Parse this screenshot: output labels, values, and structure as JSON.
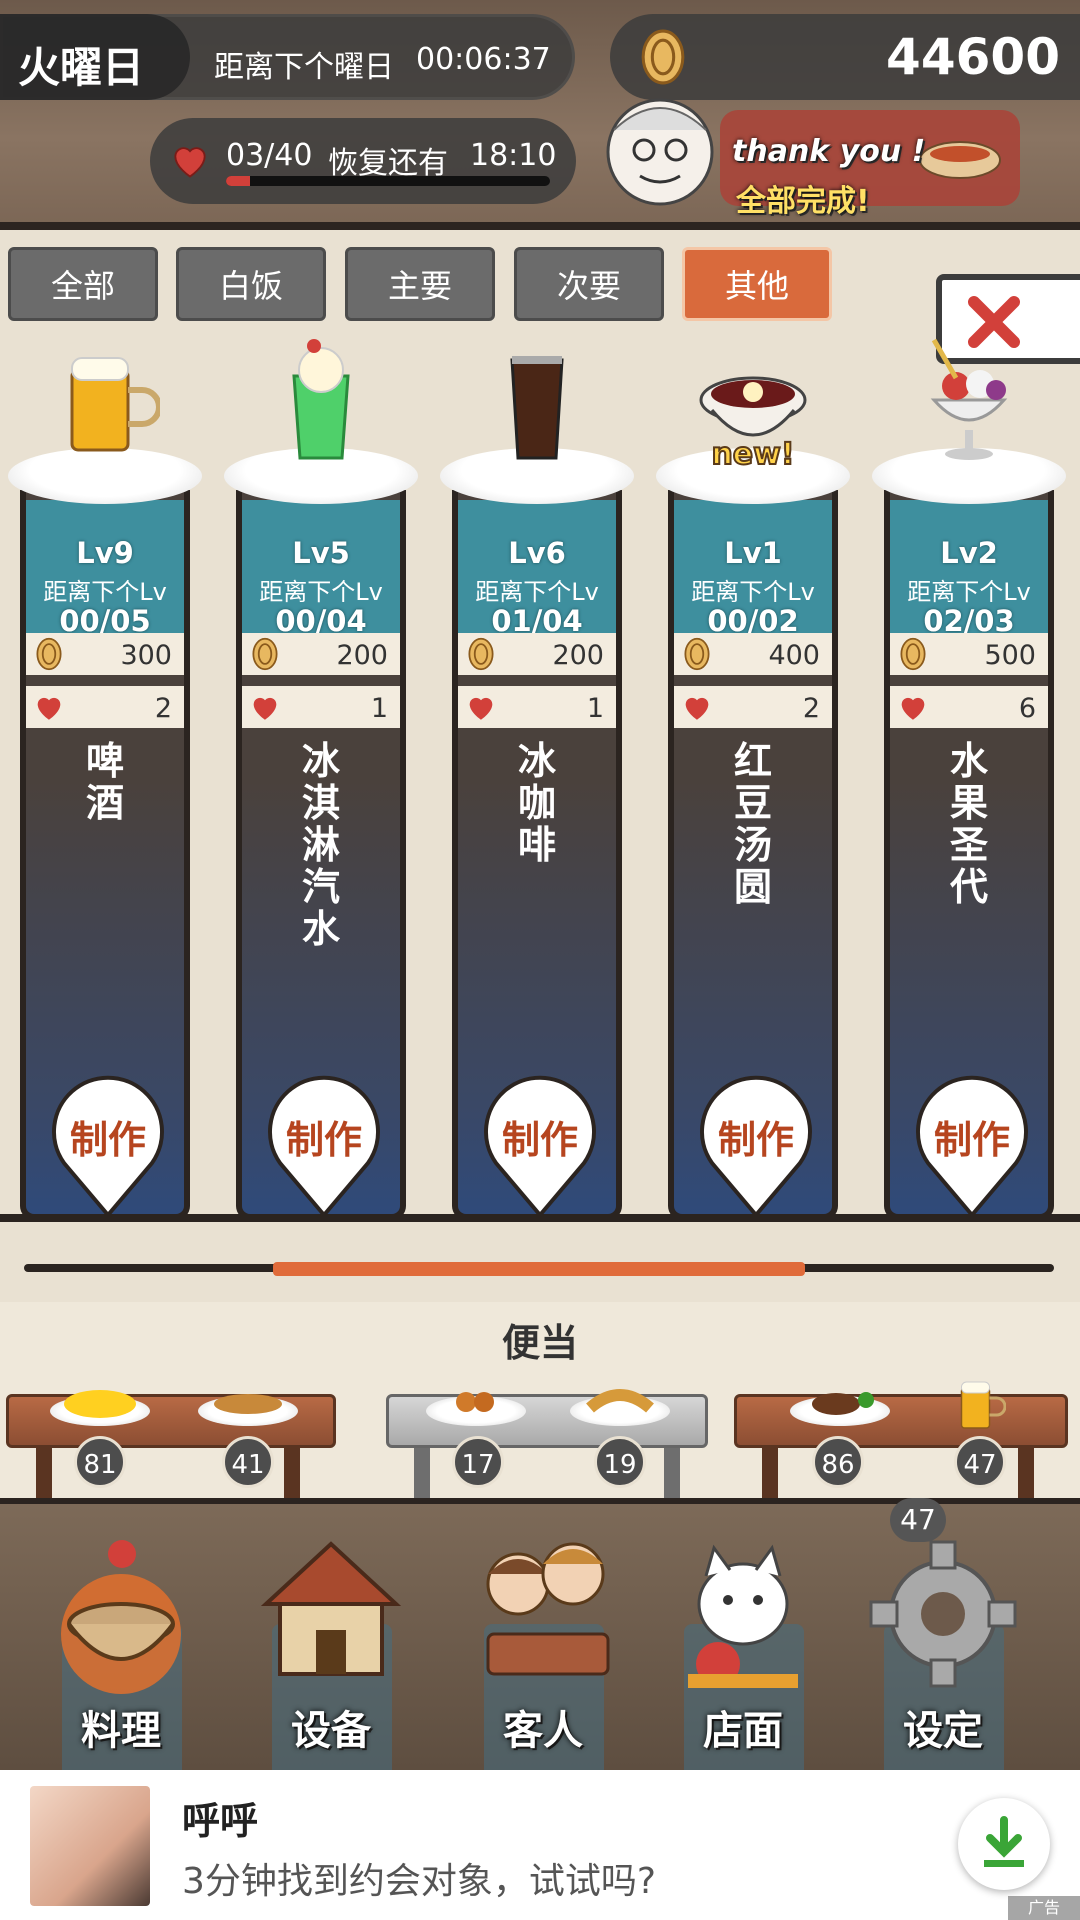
{
  "hud": {
    "day": "火曜日",
    "countdown_label": "距离下个曜日",
    "countdown_time": "00:06:37",
    "hearts": "03/40",
    "hearts_fraction": 0.075,
    "recover_label": "恢复还有",
    "recover_time": "18:10",
    "coins": "44600",
    "banner_line1": "thank you !",
    "banner_line2": "全部完成!"
  },
  "tabs": [
    {
      "label": "全部",
      "active": false
    },
    {
      "label": "白饭",
      "active": false
    },
    {
      "label": "主要",
      "active": false
    },
    {
      "label": "次要",
      "active": false
    },
    {
      "label": "其他",
      "active": true
    }
  ],
  "dishes": [
    {
      "icon": "beer-icon",
      "lv": "Lv9",
      "next_label": "距离下个Lv",
      "progress": "00/05",
      "price": "300",
      "hearts": "2",
      "name": "啤酒",
      "make": "制作",
      "badge": ""
    },
    {
      "icon": "cream-soda-icon",
      "lv": "Lv5",
      "next_label": "距离下个Lv",
      "progress": "00/04",
      "price": "200",
      "hearts": "1",
      "name": "冰淇淋汽水",
      "make": "制作",
      "badge": ""
    },
    {
      "icon": "iced-coffee-icon",
      "lv": "Lv6",
      "next_label": "距离下个Lv",
      "progress": "01/04",
      "price": "200",
      "hearts": "1",
      "name": "冰咖啡",
      "make": "制作",
      "badge": ""
    },
    {
      "icon": "red-bean-soup-icon",
      "lv": "Lv1",
      "next_label": "距离下个Lv",
      "progress": "00/02",
      "price": "400",
      "hearts": "2",
      "name": "红豆汤圆",
      "make": "制作",
      "badge": "new!"
    },
    {
      "icon": "fruit-sundae-icon",
      "lv": "Lv2",
      "next_label": "距离下个Lv",
      "progress": "02/03",
      "price": "500",
      "hearts": "6",
      "name": "水果圣代",
      "make": "制作",
      "badge": ""
    }
  ],
  "scroll_position": 0.5,
  "bento": {
    "title": "便当",
    "items": [
      {
        "icon": "omelette-icon",
        "count": "81"
      },
      {
        "icon": "grilled-fish-icon",
        "count": "41"
      },
      {
        "icon": "karaage-icon",
        "count": "17"
      },
      {
        "icon": "fried-shrimp-icon",
        "count": "19"
      },
      {
        "icon": "hamburg-steak-icon",
        "count": "86"
      },
      {
        "icon": "beer-icon",
        "count": "47"
      }
    ]
  },
  "nav": {
    "badge": "47",
    "items": [
      {
        "label": "料理",
        "icon": "cooking-pot-icon"
      },
      {
        "label": "设备",
        "icon": "house-icon"
      },
      {
        "label": "客人",
        "icon": "customers-icon"
      },
      {
        "label": "店面",
        "icon": "lucky-cat-icon"
      },
      {
        "label": "设定",
        "icon": "gear-icon"
      }
    ]
  },
  "ad": {
    "title": "呼呼",
    "subtitle": "3分钟找到约会对象，试试吗?",
    "tag": "广告"
  },
  "colors": {
    "accent": "#d96a3c",
    "panel_teal": "#3e8f9e",
    "heart_red": "#d2403a",
    "make_text": "#b6451f"
  }
}
